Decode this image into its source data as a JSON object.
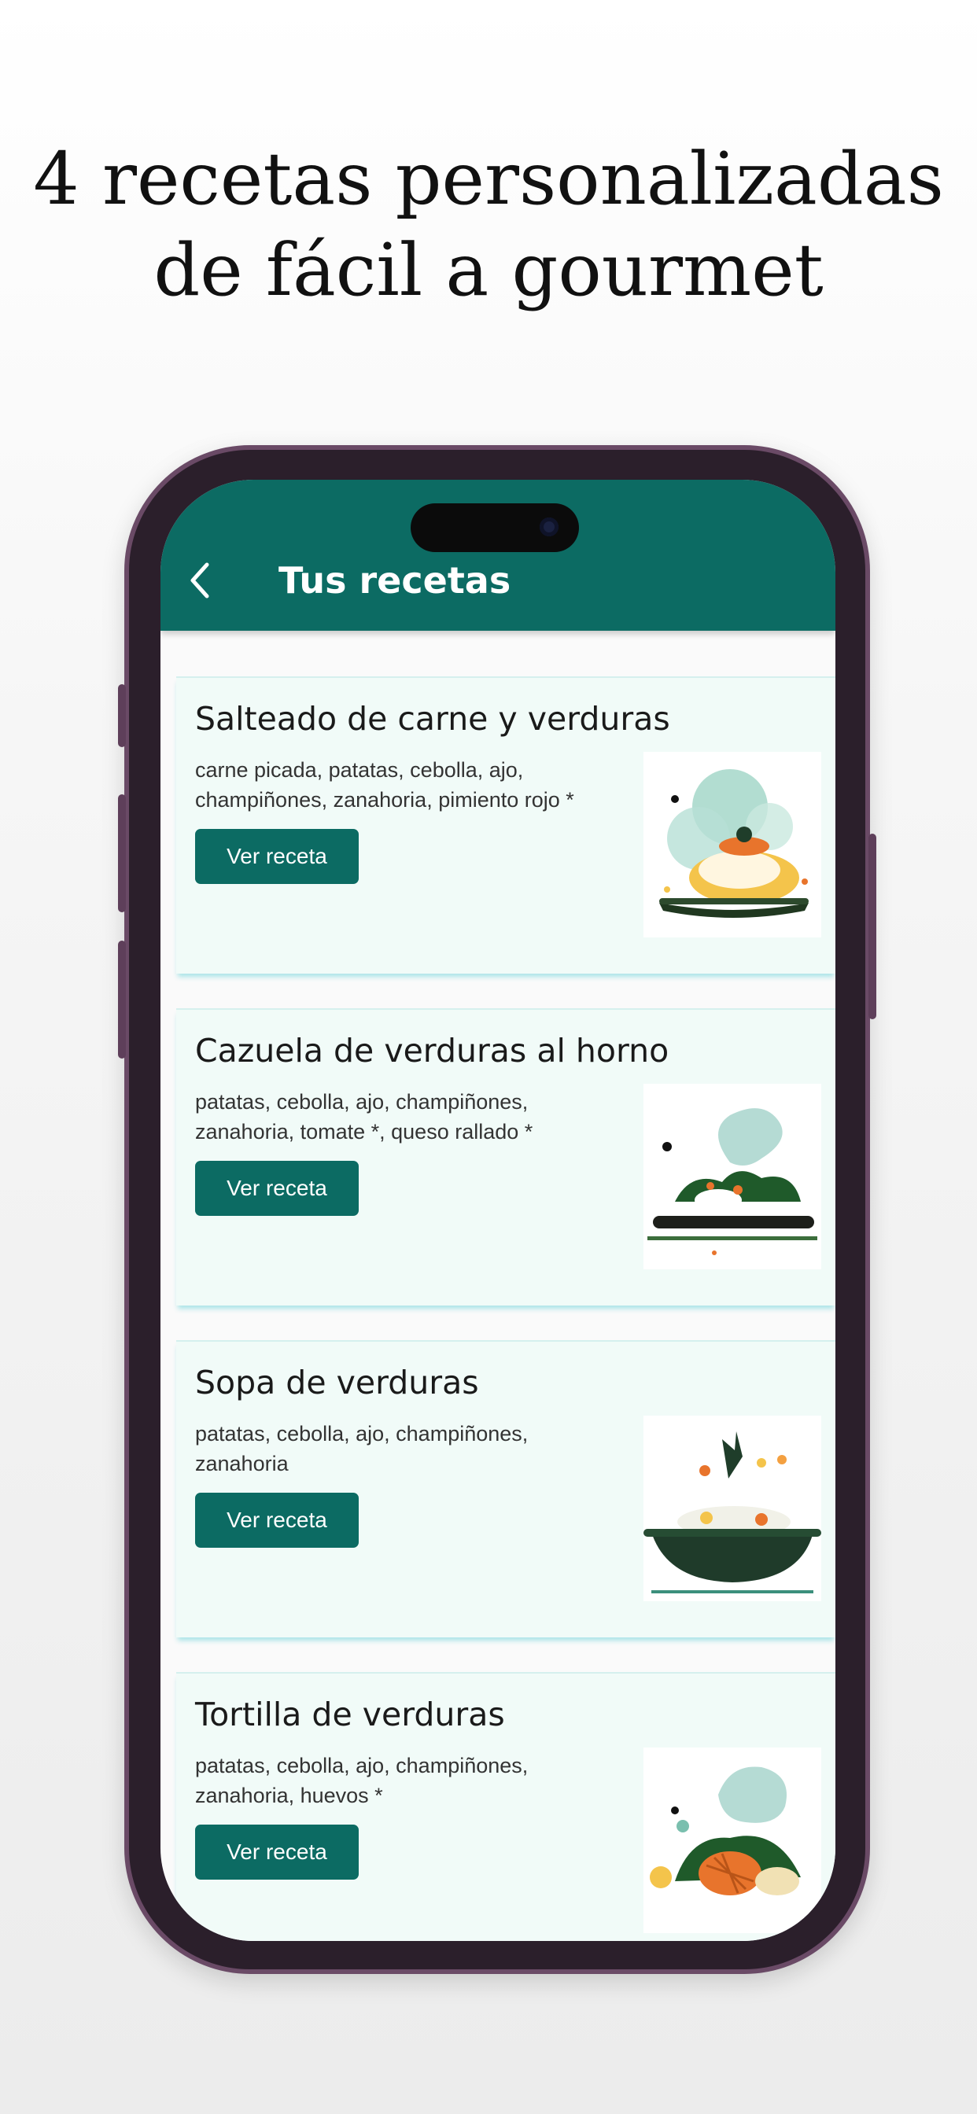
{
  "promo": {
    "title_line1": "4 recetas personalizadas",
    "title_line2": "de fácil a gourmet"
  },
  "header": {
    "title": "Tus recetas",
    "back_icon": "chevron-left-icon"
  },
  "colors": {
    "brand": "#0c6b63",
    "card_bg": "#f1fbf8",
    "card_shadow": "#a0e1e4",
    "frame": "#6a4a66"
  },
  "recipes": [
    {
      "title": "Salteado de carne y verduras",
      "ingredients": "carne picada, patatas, cebolla, ajo, champiñones, zanahoria, pimiento rojo *",
      "button": "Ver receta"
    },
    {
      "title": "Cazuela de verduras al horno",
      "ingredients": "patatas, cebolla, ajo, champiñones, zanahoria, tomate *, queso rallado *",
      "button": "Ver receta"
    },
    {
      "title": "Sopa de verduras",
      "ingredients": "patatas, cebolla, ajo, champiñones, zanahoria",
      "button": "Ver receta"
    },
    {
      "title": "Tortilla de verduras",
      "ingredients": "patatas, cebolla, ajo, champiñones, zanahoria, huevos *",
      "button": "Ver receta"
    }
  ]
}
